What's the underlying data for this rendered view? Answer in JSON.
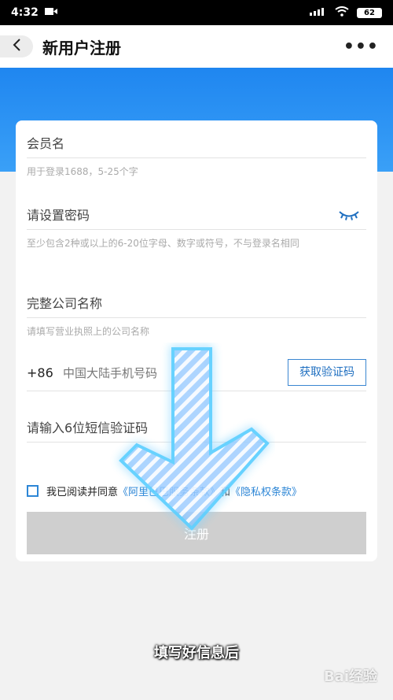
{
  "status_bar": {
    "time": "4:32",
    "battery": "62"
  },
  "nav": {
    "title": "新用户注册",
    "more": "•••"
  },
  "form": {
    "member_name": {
      "placeholder": "会员名",
      "hint": "用于登录1688，5-25个字"
    },
    "password": {
      "placeholder": "请设置密码",
      "hint": "至少包含2种或以上的6-20位字母、数字或符号，不与登录名相同"
    },
    "company": {
      "placeholder": "完整公司名称",
      "hint": "请填写营业执照上的公司名称"
    },
    "phone": {
      "country_code": "+86",
      "placeholder": "中国大陆手机号码",
      "code_button": "获取验证码"
    },
    "sms_code": {
      "placeholder": "请输入6位短信验证码"
    },
    "agreement": {
      "prefix": "我已阅读并同意",
      "terms_link": "《阿里巴巴服务条款》",
      "and": "和",
      "privacy_link": "《隐私权条款》",
      "checked": false
    },
    "register_button": "注册"
  },
  "caption": "填写好信息后",
  "watermark": "Bai经验",
  "colors": {
    "primary_blue": "#1f86f0",
    "link_blue": "#2d86d6",
    "button_disabled": "#cfcfcf"
  }
}
